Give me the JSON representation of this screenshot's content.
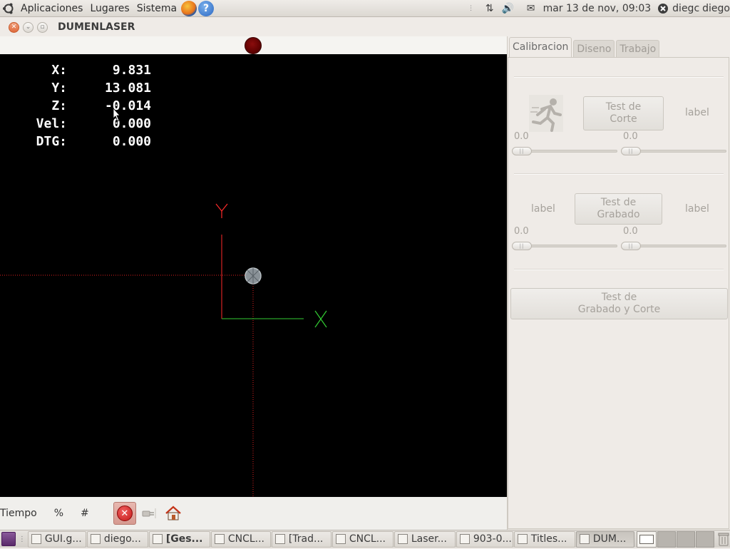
{
  "top_panel": {
    "menus": [
      "Aplicaciones",
      "Lugares",
      "Sistema"
    ],
    "datetime": "mar 13 de nov, 09:03",
    "user_left": "diegc",
    "user_right": "diego"
  },
  "window": {
    "title": "DUMENLASER"
  },
  "dro": {
    "rows": [
      {
        "label": "X:",
        "value": "9.831"
      },
      {
        "label": "Y:",
        "value": "13.081"
      },
      {
        "label": "Z:",
        "value": "-0.014"
      },
      {
        "label": "Vel:",
        "value": "0.000"
      },
      {
        "label": "DTG:",
        "value": "0.000"
      }
    ]
  },
  "preview": {
    "x_axis_label": "X",
    "y_axis_label": "Y",
    "x_axis_color": "#33cc33",
    "y_axis_color": "#ff2a2a",
    "crosshair_color": "#e02020"
  },
  "status": {
    "tiempo_label": "Tiempo",
    "percent_label": "%",
    "hash_label": "#"
  },
  "notebook": {
    "tabs": [
      "Calibracion",
      "Diseno",
      "Trabajo"
    ],
    "active_tab": "Calibracion",
    "section1": {
      "button_line1": "Test de",
      "button_line2": "Corte",
      "label_right": "label",
      "scale_left_value": "0.0",
      "scale_right_value": "0.0"
    },
    "section2": {
      "label_left": "label",
      "button_line1": "Test de",
      "button_line2": "Grabado",
      "label_right": "label",
      "scale_left_value": "0.0",
      "scale_right_value": "0.0"
    },
    "section3": {
      "button_line1": "Test de",
      "button_line2": "Grabado y Corte"
    }
  },
  "taskbar": {
    "tasks": [
      {
        "label": "GUI.g...",
        "bold": false,
        "active": false
      },
      {
        "label": "diego...",
        "bold": false,
        "active": false
      },
      {
        "label": "[Ges...",
        "bold": true,
        "active": false
      },
      {
        "label": "CNCL...",
        "bold": false,
        "active": false
      },
      {
        "label": "[Trad...",
        "bold": false,
        "active": false
      },
      {
        "label": "CNCL...",
        "bold": false,
        "active": false
      },
      {
        "label": "Laser...",
        "bold": false,
        "active": false
      },
      {
        "label": "903-0...",
        "bold": false,
        "active": false
      },
      {
        "label": "Titles...",
        "bold": false,
        "active": false
      },
      {
        "label": "DUM...",
        "bold": false,
        "active": true
      }
    ]
  }
}
